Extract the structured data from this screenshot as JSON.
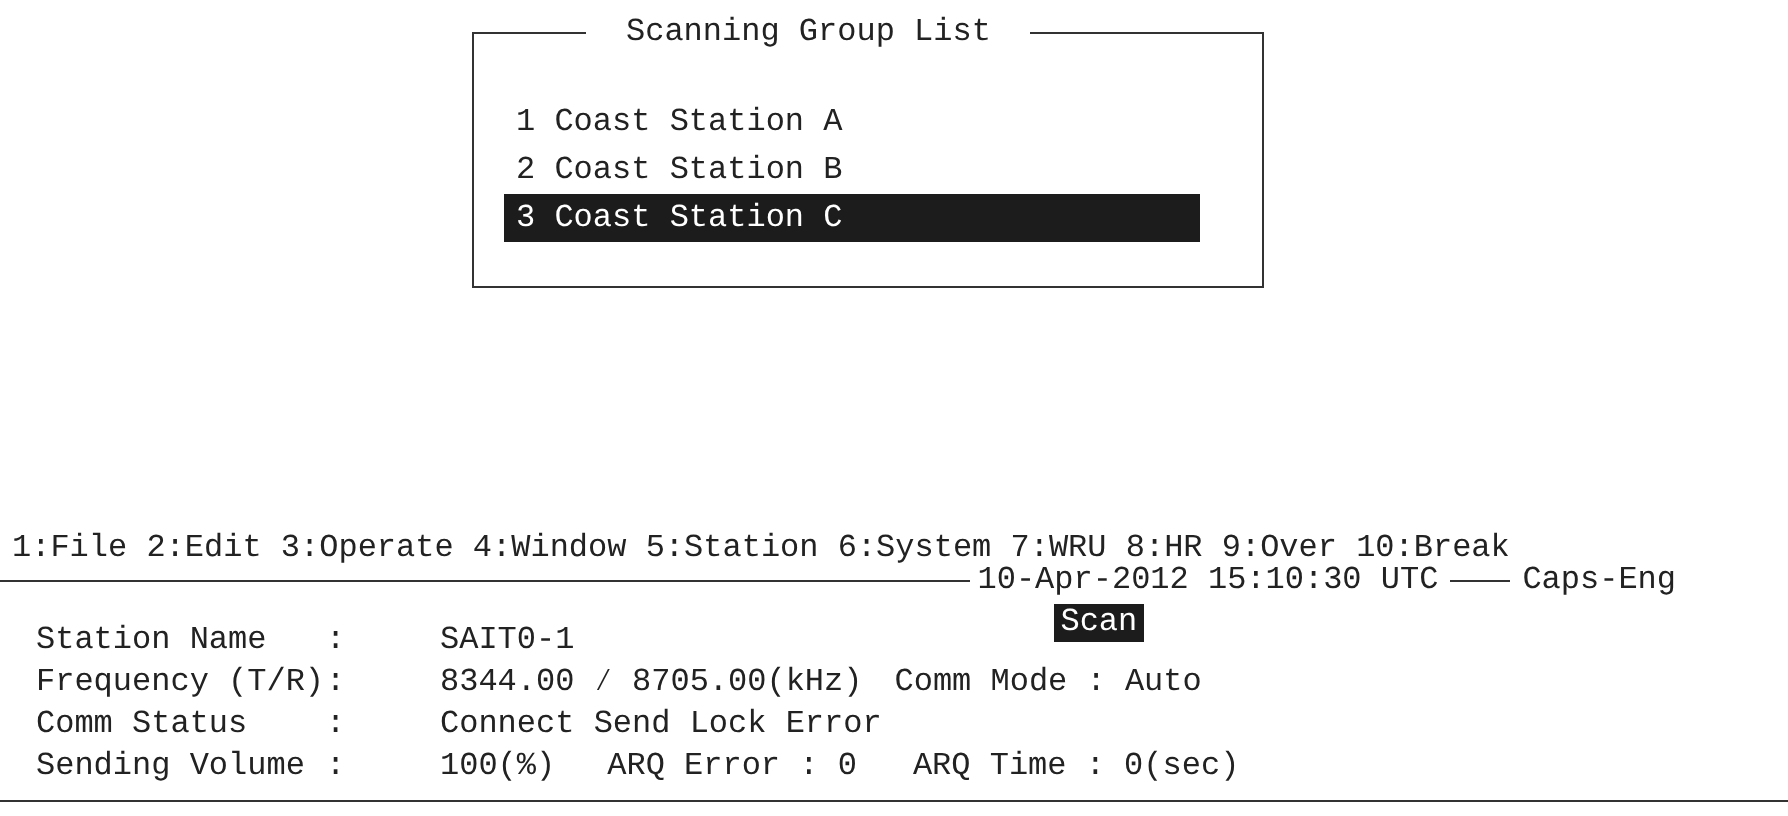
{
  "scanning_group_list": {
    "title": "Scanning Group List",
    "items": [
      {
        "number": "1",
        "name": "Coast Station A",
        "selected": false
      },
      {
        "number": "2",
        "name": "Coast Station B",
        "selected": false
      },
      {
        "number": "3",
        "name": "Coast Station C",
        "selected": true
      }
    ]
  },
  "menu": [
    "1:File",
    "2:Edit",
    "3:Operate",
    "4:Window",
    "5:Station",
    "6:System",
    "7:WRU",
    "8:HR",
    "9:Over",
    "10:Break"
  ],
  "header": {
    "datetime": "10-Apr-2012 15:10:30 UTC",
    "input_mode": "Caps-Eng"
  },
  "status": {
    "rows": [
      {
        "label": "Station Name",
        "value": "SAIT0-1",
        "extras": [
          {
            "text": "Scan",
            "highlighted": true
          }
        ]
      },
      {
        "label": "Frequency (T/R)",
        "value": "8344.00 ⁄ 8705.00(kHz)",
        "extras": [
          {
            "text": "Comm Mode : Auto",
            "highlighted": false
          }
        ]
      },
      {
        "label": "Comm Status",
        "value": "Connect Send Lock Error",
        "extras": []
      },
      {
        "label": "Sending Volume",
        "value": "100(%)",
        "extras": [
          {
            "text": "ARQ Error : 0",
            "highlighted": false
          },
          {
            "text": "ARQ Time : 0(sec)",
            "highlighted": false
          }
        ]
      }
    ],
    "separator": ":"
  }
}
